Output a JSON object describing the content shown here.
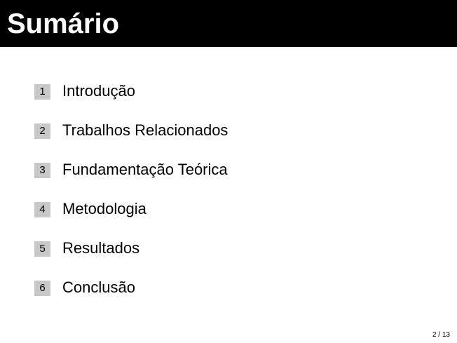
{
  "slide": {
    "title": "Sumário",
    "page_number": "2 / 13"
  },
  "toc": {
    "items": [
      {
        "number": "1",
        "label": "Introdução"
      },
      {
        "number": "2",
        "label": "Trabalhos Relacionados"
      },
      {
        "number": "3",
        "label": "Fundamentação Teórica"
      },
      {
        "number": "4",
        "label": "Metodologia"
      },
      {
        "number": "5",
        "label": "Resultados"
      },
      {
        "number": "6",
        "label": "Conclusão"
      }
    ]
  },
  "colors": {
    "title_bar": "#000000",
    "title_text": "#ffffff",
    "number_box": "#c8c8c8"
  }
}
